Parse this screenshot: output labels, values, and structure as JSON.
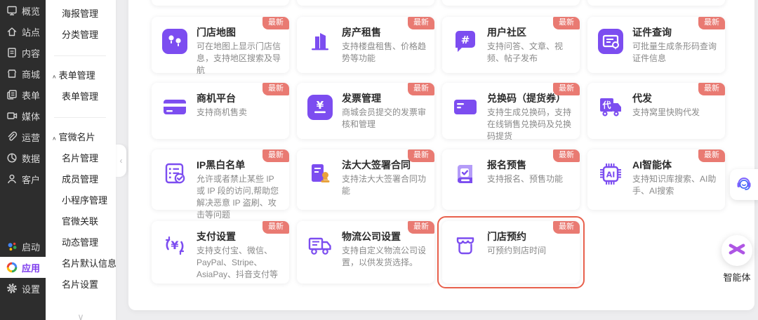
{
  "colors": {
    "accent_purple": "#7C4DF0",
    "light_purple": "#B49CF8",
    "badge_red": "#E97A72",
    "highlight_border": "#E8604C",
    "sidebar_dark": "#2D2D2D",
    "stamp_orange": "#E9A23B"
  },
  "primary_nav": {
    "items": [
      {
        "label": "概览",
        "icon": "overview-icon"
      },
      {
        "label": "站点",
        "icon": "site-icon"
      },
      {
        "label": "内容",
        "icon": "content-icon"
      },
      {
        "label": "商城",
        "icon": "mall-icon"
      },
      {
        "label": "表单",
        "icon": "form-icon"
      },
      {
        "label": "媒体",
        "icon": "media-icon"
      },
      {
        "label": "运营",
        "icon": "operations-icon"
      },
      {
        "label": "数据",
        "icon": "data-icon"
      },
      {
        "label": "客户",
        "icon": "customer-icon"
      }
    ],
    "bottom_items": [
      {
        "label": "启动",
        "icon": "launch-icon",
        "active": false
      },
      {
        "label": "应用",
        "icon": "apps-icon",
        "active": true
      },
      {
        "label": "设置",
        "icon": "settings-icon",
        "active": false
      }
    ]
  },
  "secondary_nav": {
    "entries": [
      {
        "type": "item",
        "label": "海报管理"
      },
      {
        "type": "item",
        "label": "分类管理"
      },
      {
        "type": "divider"
      },
      {
        "type": "group",
        "label": "表单管理"
      },
      {
        "type": "item",
        "label": "表单管理"
      },
      {
        "type": "divider"
      },
      {
        "type": "group",
        "label": "官微名片"
      },
      {
        "type": "item",
        "label": "名片管理"
      },
      {
        "type": "item",
        "label": "成员管理"
      },
      {
        "type": "item",
        "label": "小程序管理"
      },
      {
        "type": "item",
        "label": "官微关联"
      },
      {
        "type": "item",
        "label": "动态管理"
      },
      {
        "type": "item",
        "label": "名片默认信息"
      },
      {
        "type": "item",
        "label": "名片设置"
      }
    ],
    "group_caret": "∧",
    "collapse_handle": "‹",
    "more_indicator": "∨"
  },
  "apps_grid": {
    "badge_label": "最新",
    "rows": [
      [
        {
          "title": "门店地图",
          "desc": "可在地图上显示门店信息，支持地区搜索及导航",
          "icon": "map-pins-icon",
          "highlighted": false
        },
        {
          "title": "房产租售",
          "desc": "支持楼盘租售、价格趋势等功能",
          "icon": "building-icon",
          "highlighted": false
        },
        {
          "title": "用户社区",
          "desc": "支持问答、文章、视频、帖子发布",
          "icon": "hashtag-bubble-icon",
          "highlighted": false
        },
        {
          "title": "证件查询",
          "desc": "可批量生成条形码查询证件信息",
          "icon": "certificate-icon",
          "highlighted": false
        }
      ],
      [
        {
          "title": "商机平台",
          "desc": "支持商机售卖",
          "icon": "bank-card-icon",
          "highlighted": false
        },
        {
          "title": "发票管理",
          "desc": "商城会员提交的发票审核和管理",
          "icon": "yuan-square-icon",
          "highlighted": false
        },
        {
          "title": "兑换码（提货券）",
          "desc": "支持生成兑换码，支持在线销售兑换码及兑换码提货",
          "icon": "voucher-card-icon",
          "highlighted": false
        },
        {
          "title": "代发",
          "desc": "支持窝里快购代发",
          "icon": "truck-dai-icon",
          "highlighted": false
        }
      ],
      [
        {
          "title": "IP黑白名单",
          "desc": "允许或者禁止某些 IP 或 IP 段的访问,帮助您解决恶意 IP 盗刷、攻击等问题",
          "icon": "checklist-icon",
          "highlighted": false
        },
        {
          "title": "法大大签署合同",
          "desc": "支持法大大签署合同功能",
          "icon": "contract-stamp-icon",
          "highlighted": false
        },
        {
          "title": "报名预售",
          "desc": "支持报名、预售功能",
          "icon": "book-check-icon",
          "highlighted": false
        },
        {
          "title": "AI智能体",
          "desc": "支持知识库搜索、AI助手、AI搜索",
          "icon": "ai-chip-icon",
          "highlighted": false
        }
      ],
      [
        {
          "title": "支付设置",
          "desc": "支持支付宝、微信、PayPal、Stripe、AsiaPay、抖音支付等",
          "icon": "yuan-cycle-icon",
          "highlighted": false
        },
        {
          "title": "物流公司设置",
          "desc": "支持自定义物流公司设置，以供发货选择。",
          "icon": "truck-outline-icon",
          "highlighted": false
        },
        {
          "title": "门店预约",
          "desc": "可预约到店时间",
          "icon": "storefront-icon",
          "highlighted": true
        }
      ]
    ]
  },
  "floating": {
    "service_icon": "headset-icon",
    "agent": {
      "icon": "asterisk-icon",
      "label": "智能体"
    }
  }
}
